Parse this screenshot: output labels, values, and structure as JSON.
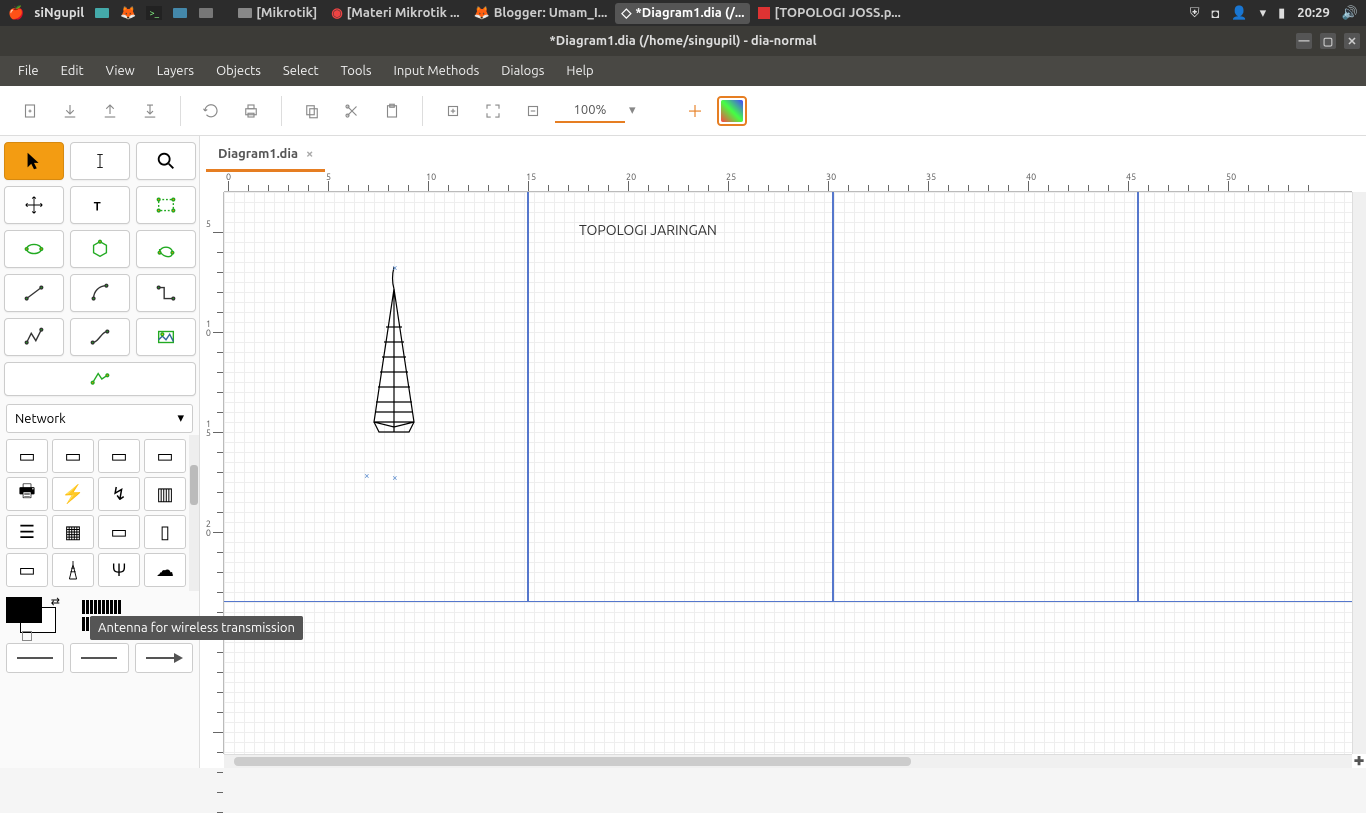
{
  "system": {
    "username": "siNgupil",
    "taskbar_apps": [
      {
        "name": "[Mikrotik]",
        "icon": "folder"
      },
      {
        "name": "[Materi Mikrotik ...",
        "icon": "opera"
      },
      {
        "name": "Blogger: Umam_I...",
        "icon": "firefox"
      },
      {
        "name": "*Diagram1.dia (/...",
        "icon": "dia",
        "active": true
      },
      {
        "name": "[TOPOLOGI JOSS.p...",
        "icon": "wps"
      }
    ],
    "time": "20:29"
  },
  "window": {
    "title": "*Diagram1.dia (/home/singupil) - dia-normal"
  },
  "menus": [
    "File",
    "Edit",
    "View",
    "Layers",
    "Objects",
    "Select",
    "Tools",
    "Input Methods",
    "Dialogs",
    "Help"
  ],
  "toolbar": {
    "zoom": "100%"
  },
  "tab": {
    "name": "Diagram1.dia"
  },
  "sidebar": {
    "category": "Network",
    "tooltip": "Antenna for wireless transmission"
  },
  "canvas": {
    "title_text": "TOPOLOGI JARINGAN",
    "ruler_labels_h": [
      "0",
      "5",
      "10",
      "15",
      "20",
      "25",
      "30",
      "35",
      "40",
      "45",
      "50"
    ],
    "ruler_labels_v": [
      "5",
      "10",
      "15",
      "20"
    ]
  }
}
